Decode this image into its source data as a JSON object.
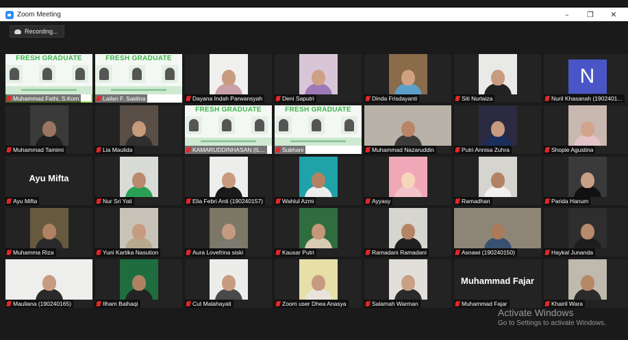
{
  "window": {
    "title": "Zoom Meeting",
    "controls": [
      "–",
      "❐",
      "✕"
    ]
  },
  "recording": {
    "label": "Recording..."
  },
  "banner": {
    "title": "FRESH GRADUATE"
  },
  "colors": {
    "accent": "#2D8CFF",
    "speaker_outline": "#9BE35A",
    "banner_green": "#3CB34A",
    "mic_muted": "#E02828",
    "avatar_bg": "#4A56C6"
  },
  "participants": [
    {
      "name": "Muhammad Fathi, S.Kom",
      "type": "banner",
      "speaker": true
    },
    {
      "name": "Lailan F. Saidina",
      "type": "banner-person"
    },
    {
      "name": "Dayana Indah Parwansyah",
      "type": "video",
      "bg": "#f0f0ee",
      "skin": "#c79b80",
      "cloth": "#caa0a8"
    },
    {
      "name": "Deni Saputri",
      "type": "video",
      "bg": "#d8c6d8",
      "skin": "#cfa088",
      "cloth": "#9d79b6"
    },
    {
      "name": "Dinda Frisdayanti",
      "type": "video",
      "bg": "#8a6b4a",
      "skin": "#d1a17f",
      "cloth": "#5aa0c8"
    },
    {
      "name": "Siti Nurlaiza",
      "type": "video",
      "bg": "#e9e9e7",
      "skin": "#c89a7e",
      "cloth": "#222222"
    },
    {
      "name": "Nuril Khasanah (1902401...",
      "type": "avatar",
      "letter": "N"
    },
    {
      "name": "Muhammad Tamimi",
      "type": "video",
      "bg": "#3a3a3a",
      "skin": "#9a7560",
      "cloth": "#1e1e1e"
    },
    {
      "name": "Lia Maulida",
      "type": "video",
      "bg": "#5a4f47",
      "skin": "#c69a7c",
      "cloth": "#2f2f2f"
    },
    {
      "name": "KAMARUDDINHASAN (IL...",
      "type": "banner-person"
    },
    {
      "name": "Subhani",
      "type": "banner-person"
    },
    {
      "name": "Muhammad Nazaruddin",
      "type": "video",
      "wide": true,
      "bg": "#b9b2a8",
      "skin": "#b88566",
      "cloth": "#3c3c3c"
    },
    {
      "name": "Putri Annisa Zuhra",
      "type": "video",
      "bg": "#2a2a40",
      "skin": "#c79b80",
      "cloth": "#1b2d5a"
    },
    {
      "name": "Shopie Agustina",
      "type": "video",
      "bg": "#c8b8b0",
      "skin": "#d2a48c",
      "cloth": "#e3c4c8"
    },
    {
      "name": "Ayu Mifta",
      "type": "text",
      "display": "Ayu Mifta"
    },
    {
      "name": "Nur Sri Yati",
      "type": "video",
      "bg": "#d9dcd6",
      "skin": "#b98a6e",
      "cloth": "#2aa055"
    },
    {
      "name": "Elia Febri Anti (190240157)",
      "type": "video",
      "bg": "#ededeb",
      "skin": "#c89a7e",
      "cloth": "#1a1a1a"
    },
    {
      "name": "Wahlul Azmi",
      "type": "video",
      "bg": "#1fa3a8",
      "skin": "#b48262",
      "cloth": "#ececec"
    },
    {
      "name": "Ayyasy",
      "type": "video",
      "bg": "#f0a8b8",
      "skin": "#f5d6b8",
      "cloth": "#f3c3c9"
    },
    {
      "name": "Ramadhan",
      "type": "video",
      "bg": "#d6d4cf",
      "skin": "#b28263",
      "cloth": "#f0f0f0"
    },
    {
      "name": "Parida Hanum",
      "type": "video",
      "bg": "#3a3a3a",
      "skin": "#c9a085",
      "cloth": "#111111"
    },
    {
      "name": "Muhamma Riza",
      "type": "video",
      "bg": "#665a3e",
      "skin": "#b08262",
      "cloth": "#2a2a2a"
    },
    {
      "name": "Yuni Kartika Nasution",
      "type": "video",
      "bg": "#c8c3b8",
      "skin": "#c79b7f",
      "cloth": "#b7a98f"
    },
    {
      "name": "Aura Lovefrina siski",
      "type": "video",
      "bg": "#7d7866",
      "skin": "#c49a80",
      "cloth": "#7b7b70"
    },
    {
      "name": "Kausar Putri",
      "type": "video",
      "bg": "#2f6d3f",
      "skin": "#c59678",
      "cloth": "#d8cbb4"
    },
    {
      "name": "Ramadani Ramadani",
      "type": "video",
      "bg": "#d7d5d0",
      "skin": "#b48464",
      "cloth": "#202020"
    },
    {
      "name": "Asnawi (190240150)",
      "type": "video",
      "wide": true,
      "bg": "#8d8676",
      "skin": "#aa7a5b",
      "cloth": "#3a5070"
    },
    {
      "name": "Haykal Junanda",
      "type": "video",
      "bg": "#2e2e2e",
      "skin": "#b78a6c",
      "cloth": "#1d1d1d"
    },
    {
      "name": "Mauliana (190240165)",
      "type": "video",
      "wide": true,
      "bg": "#eeeeec",
      "skin": "#c79b80",
      "cloth": "#2a2a2a"
    },
    {
      "name": "Ilham Baihaqi",
      "type": "video",
      "bg": "#1f6d3f",
      "skin": "#b08262",
      "cloth": "#232323"
    },
    {
      "name": "Cut Malahayati",
      "type": "video",
      "bg": "#ececea",
      "skin": "#c89c80",
      "cloth": "#4a4a4a"
    },
    {
      "name": "Zoom user Dhea Anasya",
      "type": "video",
      "bg": "#e6dfa8",
      "skin": "#c79b80",
      "cloth": "#e8e4dc"
    },
    {
      "name": "Salamah Warman",
      "type": "video",
      "bg": "#e2dfda",
      "skin": "#c8a085",
      "cloth": "#2a2a2a"
    },
    {
      "name": "Muhammad Fajar",
      "type": "text",
      "display": "Muhammad Fajar"
    },
    {
      "name": "Khairil Wara",
      "type": "video",
      "bg": "#bfb9ae",
      "skin": "#b78866",
      "cloth": "#2b2b2b"
    }
  ],
  "watermark": {
    "line1": "Activate Windows",
    "line2": "Go to Settings to activate Windows."
  }
}
